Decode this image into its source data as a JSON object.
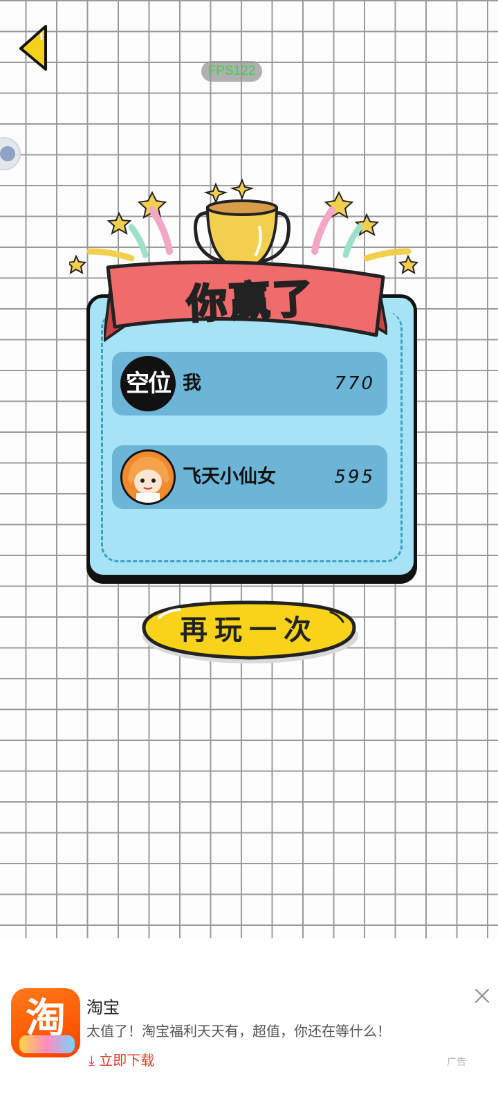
{
  "hud": {
    "fps_label": "FPS122"
  },
  "result": {
    "title": "你赢了",
    "players": [
      {
        "avatar_text": "空位",
        "name": "我",
        "score": "770"
      },
      {
        "avatar_text": "",
        "name": "飞天小仙女",
        "score": "595"
      }
    ],
    "replay_label": "再玩一次"
  },
  "ad": {
    "icon_char": "淘",
    "title": "淘宝",
    "description": "太值了！淘宝福利天天有，超值，你还在等什么！",
    "cta": "⤓ 立即下载",
    "tag": "广告"
  },
  "colors": {
    "panel": "#a7e3f7",
    "row": "#6cb5d7",
    "banner": "#f06b6b",
    "trophy": "#f3cf4e",
    "cta": "#e33b2e"
  }
}
